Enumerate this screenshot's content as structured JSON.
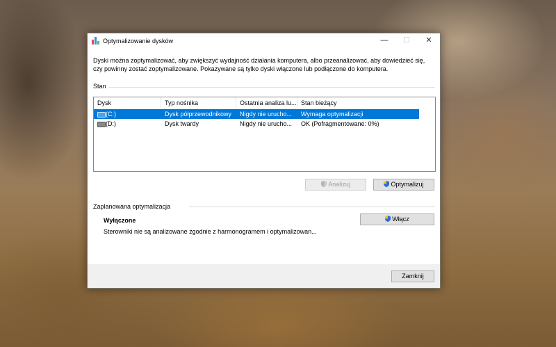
{
  "window": {
    "title": "Optymalizowanie dysków",
    "minimize_glyph": "—",
    "maximize_glyph": "☐",
    "close_glyph": "✕"
  },
  "description_line1": "Dyski można zoptymalizować, aby zwiększyć wydajność działania komputera, albo przeanalizować, aby dowiedzieć się,",
  "description_line2": "czy powinny zostać zoptymalizowane. Pokazywane są tylko dyski włączone lub podłączone do komputera.",
  "status_section": {
    "label": "Stan",
    "columns": [
      "Dysk",
      "Typ nośnika",
      "Ostatnia analiza lu...",
      "Stan bieżący"
    ],
    "rows": [
      {
        "drive": "(C:)",
        "media_type": "Dysk półprzewodnikowy",
        "last_run": "Nigdy nie urucho...",
        "status": "Wymaga optymalizacji",
        "selected": true
      },
      {
        "drive": "(D:)",
        "media_type": "Dysk twardy",
        "last_run": "Nigdy nie urucho...",
        "status": "OK (Pofragmentowane: 0%)",
        "selected": false
      }
    ],
    "analyze_button": "Analizuj",
    "optimize_button": "Optymalizuj"
  },
  "schedule_section": {
    "label": "Zaplanowana optymalizacja",
    "state": "Wyłączone",
    "description": "Sterowniki nie są analizowane zgodnie z harmonogramem i optymalizowan...",
    "enable_button": "Włącz"
  },
  "close_button": "Zamknij",
  "colors": {
    "selection": "#0078d7",
    "button_face": "#e1e1e1",
    "footer": "#f0f0f0"
  }
}
